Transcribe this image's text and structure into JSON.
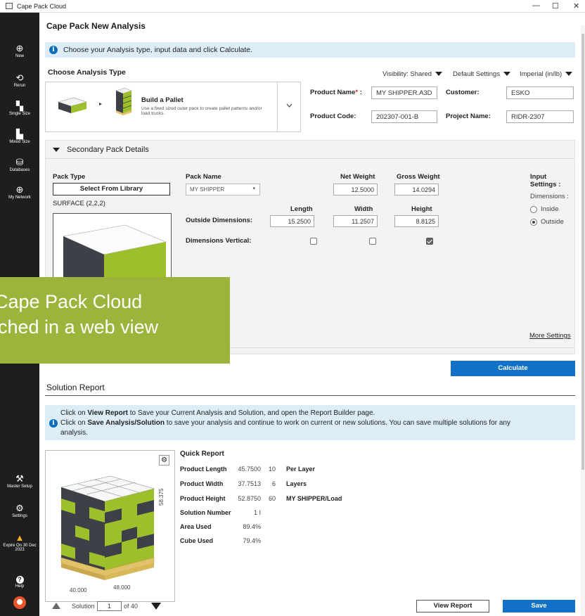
{
  "window": {
    "title": "Cape Pack Cloud",
    "minimize": "—",
    "maximize": "☐",
    "close": "✕"
  },
  "sidebar": {
    "items": [
      {
        "label": "New",
        "icon": "plus-circle-icon",
        "glyph": "⊕"
      },
      {
        "label": "Rerun",
        "icon": "rerun-icon",
        "glyph": "⟲"
      },
      {
        "label": "Single Size",
        "icon": "single-size-icon",
        "glyph": "▚"
      },
      {
        "label": "Mixed Size",
        "icon": "mixed-size-icon",
        "glyph": "▙"
      },
      {
        "label": "Databases",
        "icon": "database-icon",
        "glyph": "⛁"
      },
      {
        "label": "My Network",
        "icon": "globe-icon",
        "glyph": "⊕"
      },
      {
        "label": "Master Setup",
        "icon": "wrench-icon",
        "glyph": "⚒"
      },
      {
        "label": "Settings",
        "icon": "gear-icon",
        "glyph": "⚙"
      },
      {
        "label": "Expire On 30 Dec 2023",
        "icon": "warning-icon",
        "glyph": "▲"
      },
      {
        "label": "Help",
        "icon": "help-icon",
        "glyph": "?"
      }
    ]
  },
  "header": {
    "title": "Cape Pack New Analysis",
    "info": "Choose your Analysis type, input data and click Calculate."
  },
  "analysis": {
    "heading": "Choose Analysis Type",
    "visibility": "Visibility: Shared",
    "defaults": "Default Settings",
    "units": "Imperial (in/lb)",
    "type_title": "Build a Pallet",
    "type_desc": "Use a fixed sized outer pack to create pallet patterns and/or load trucks."
  },
  "product": {
    "name_label": "Product Name",
    "name_req": "*",
    "name_colon": " :",
    "name_value": "MY SHIPPER.A3D",
    "customer_label": "Customer:",
    "customer_value": "ESKO",
    "code_label": "Product Code:",
    "code_value": "202307-001-B",
    "project_label": "Project Name:",
    "project_value": "RIDR-2307"
  },
  "secondary": {
    "heading": "Secondary Pack Details",
    "pack_type_label": "Pack Type",
    "select_library": "Select From Library",
    "surface": "SURFACE (2,2,2)",
    "pack_name_label": "Pack Name",
    "pack_name_value": "MY SHIPPER",
    "net_weight_label": "Net Weight",
    "net_weight": "12.5000",
    "gross_weight_label": "Gross Weight",
    "gross_weight": "14.0294",
    "length_label": "Length",
    "width_label": "Width",
    "height_label": "Height",
    "outside_dim_label": "Outside Dimensions:",
    "length": "15.2500",
    "width": "11.2507",
    "height": "8.8125",
    "dim_vertical_label": "Dimensions Vertical:",
    "vertical": {
      "length": false,
      "width": false,
      "height": true
    },
    "input_settings": "Input Settings :",
    "dimensions_label": "Dimensions :",
    "inside": "Inside",
    "outside": "Outside",
    "selected": "outside",
    "more_settings": "More Settings"
  },
  "overlay": {
    "line1": "Cape Pack Cloud",
    "line2": "ched in a web view"
  },
  "calculate": "Calculate",
  "solution": {
    "heading": "Solution Report",
    "info_pre1": "Click on ",
    "info_b1": "View Report",
    "info_post1": " to Save your Current Analysis and Solution, and open the Report Builder page.",
    "info_pre2": "Click on ",
    "info_b2": "Save Analysis/Solution",
    "info_post2": " to save your analysis and continue to work on current or new solutions. You can save multiple solutions for any",
    "info_line3": "analysis.",
    "dim_height": "58.375",
    "dim_left": "40.000",
    "dim_right": "48.000",
    "quick_report": "Quick Report",
    "rows": [
      {
        "label": "Product Length",
        "value": "45.7500",
        "n": "10",
        "desc": "Per Layer"
      },
      {
        "label": "Product Width",
        "value": "37.7513",
        "n": "6",
        "desc": "Layers"
      },
      {
        "label": "Product Height",
        "value": "52.8750",
        "n": "60",
        "desc": "MY SHIPPER/Load"
      },
      {
        "label": "Solution Number",
        "value": "1 I",
        "n": "",
        "desc": ""
      },
      {
        "label": "Area Used",
        "value": "89.4%",
        "n": "",
        "desc": ""
      },
      {
        "label": "Cube Used",
        "value": "79.4%",
        "n": "",
        "desc": ""
      }
    ],
    "solution_label": "Solution",
    "solution_current": "1",
    "solution_of": "of 40",
    "view_report": "View Report",
    "save_analysis": "Save Analysis/Solution"
  },
  "colors": {
    "accent_blue": "#1071c6",
    "banner": "#dcedf7",
    "box_green": "#9cbf2b",
    "box_dark": "#3d4046",
    "overlay_green": "#9cb43c"
  }
}
